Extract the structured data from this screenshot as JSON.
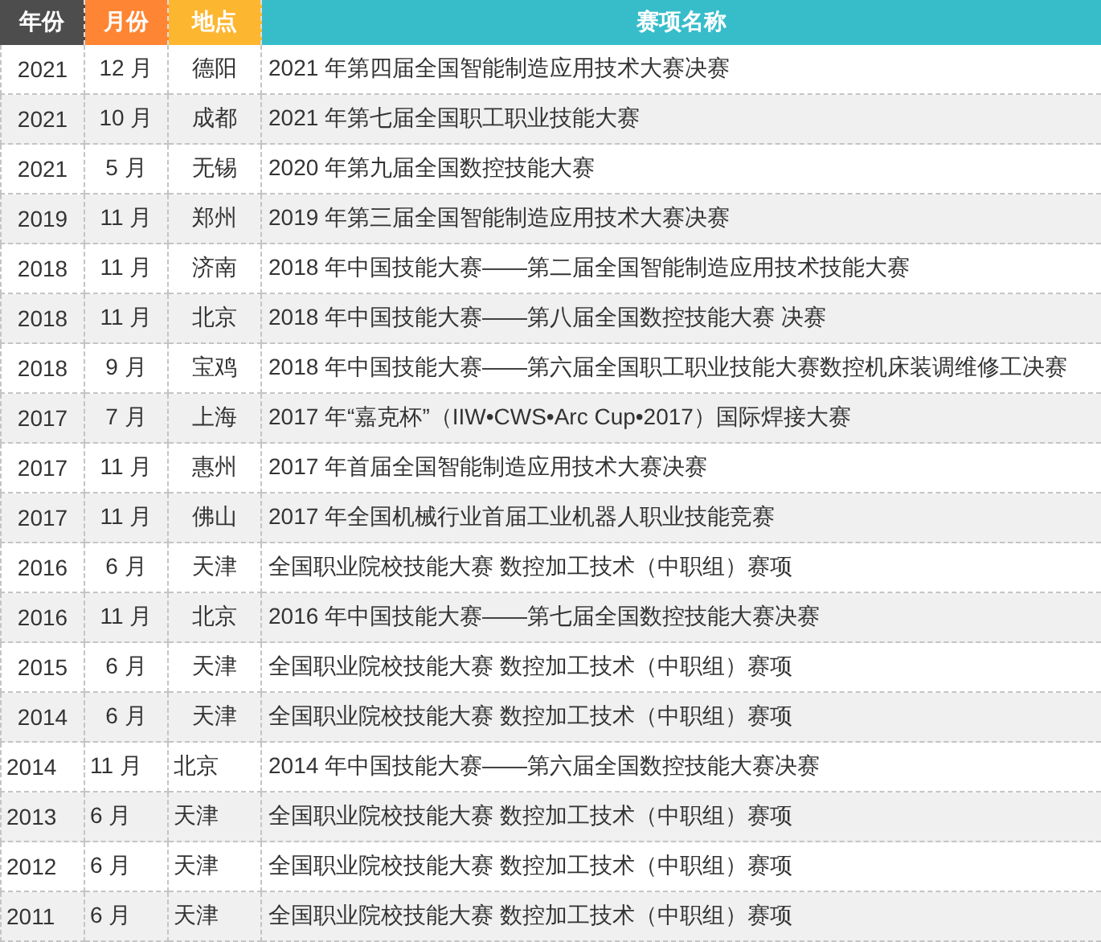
{
  "columns": [
    {
      "label": "年份",
      "color": "#4d4d4d"
    },
    {
      "label": "月份",
      "color": "#fe8533"
    },
    {
      "label": "地点",
      "color": "#fdb62f"
    },
    {
      "label": "赛项名称",
      "color": "#37bdca"
    }
  ],
  "rows": [
    {
      "year": "2021",
      "month": "12 月",
      "place": "德阳",
      "name": "2021 年第四届全国智能制造应用技术大赛决赛",
      "centered": true
    },
    {
      "year": "2021",
      "month": "10 月",
      "place": "成都",
      "name": "2021 年第七届全国职工职业技能大赛",
      "centered": true
    },
    {
      "year": "2021",
      "month": "5 月",
      "place": "无锡",
      "name": "2020 年第九届全国数控技能大赛",
      "centered": true
    },
    {
      "year": "2019",
      "month": "11 月",
      "place": "郑州",
      "name": "2019 年第三届全国智能制造应用技术大赛决赛",
      "centered": true
    },
    {
      "year": "2018",
      "month": "11 月",
      "place": "济南",
      "name": "2018 年中国技能大赛——第二届全国智能制造应用技术技能大赛",
      "centered": true
    },
    {
      "year": "2018",
      "month": "11 月",
      "place": "北京",
      "name": "2018 年中国技能大赛——第八届全国数控技能大赛 决赛",
      "centered": true
    },
    {
      "year": "2018",
      "month": "9 月",
      "place": "宝鸡",
      "name": "2018 年中国技能大赛——第六届全国职工职业技能大赛数控机床装调维修工决赛",
      "centered": true
    },
    {
      "year": "2017",
      "month": "7 月",
      "place": "上海",
      "name": "2017 年“嘉克杯”（IIW•CWS•Arc Cup•2017）国际焊接大赛",
      "centered": true
    },
    {
      "year": "2017",
      "month": "11 月",
      "place": "惠州",
      "name": "2017 年首届全国智能制造应用技术大赛决赛",
      "centered": true
    },
    {
      "year": "2017",
      "month": "11 月",
      "place": "佛山",
      "name": "2017 年全国机械行业首届工业机器人职业技能竞赛",
      "centered": true
    },
    {
      "year": "2016",
      "month": "6 月",
      "place": "天津",
      "name": "全国职业院校技能大赛 数控加工技术（中职组）赛项",
      "centered": true
    },
    {
      "year": "2016",
      "month": "11 月",
      "place": "北京",
      "name": "2016 年中国技能大赛——第七届全国数控技能大赛决赛",
      "centered": true
    },
    {
      "year": "2015",
      "month": "6 月",
      "place": "天津",
      "name": "全国职业院校技能大赛 数控加工技术（中职组）赛项",
      "centered": true
    },
    {
      "year": "2014",
      "month": "6 月",
      "place": "天津",
      "name": "全国职业院校技能大赛 数控加工技术（中职组）赛项",
      "centered": true
    },
    {
      "year": "2014",
      "month": "11 月",
      "place": "北京",
      "name": "2014 年中国技能大赛——第六届全国数控技能大赛决赛",
      "centered": false
    },
    {
      "year": "2013",
      "month": "6 月",
      "place": "天津",
      "name": "全国职业院校技能大赛 数控加工技术（中职组）赛项",
      "centered": false
    },
    {
      "year": "2012",
      "month": "6 月",
      "place": "天津",
      "name": "全国职业院校技能大赛 数控加工技术（中职组）赛项",
      "centered": false
    },
    {
      "year": "2011",
      "month": "6 月",
      "place": "天津",
      "name": "全国职业院校技能大赛 数控加工技术（中职组）赛项",
      "centered": false
    }
  ]
}
